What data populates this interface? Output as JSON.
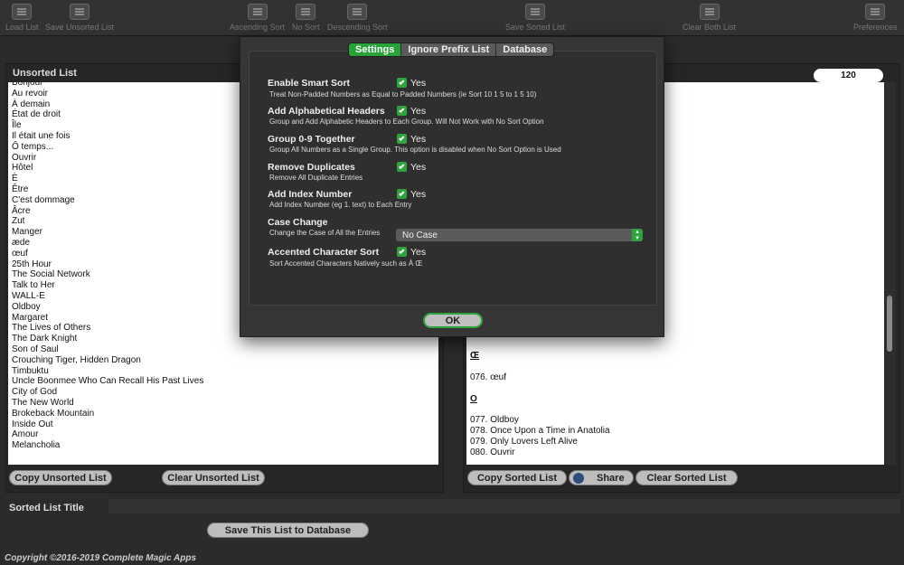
{
  "toolbar": {
    "items": [
      {
        "label": "Load List",
        "icon": "load-icon"
      },
      {
        "label": "Save Unsorted List",
        "icon": "save-icon"
      },
      {
        "label": "Ascending Sort",
        "icon": "ascending-icon"
      },
      {
        "label": "No Sort",
        "icon": "no-sort-icon"
      },
      {
        "label": "Descending Sort",
        "icon": "descending-icon"
      },
      {
        "label": "Save Sorted List",
        "icon": "save-icon"
      },
      {
        "label": "Clear Both List",
        "icon": "trash-icon"
      },
      {
        "label": "Preferences",
        "icon": "tools-icon"
      }
    ]
  },
  "unsorted": {
    "title": "Unsorted List",
    "items": [
      "Bonjour",
      "Au revoir",
      "À demain",
      "État de droit",
      "Île",
      "Il était une fois",
      "Ô temps...",
      "Ouvrir",
      "Hôtel",
      "È",
      "Être",
      "C'est dommage",
      "Âcre",
      "Zut",
      "Manger",
      "æde",
      "œuf",
      "25th Hour",
      "The Social Network",
      "Talk to Her",
      "WALL-E",
      "Oldboy",
      "Margaret",
      "The Lives of Others",
      "The Dark Knight",
      "Son of Saul",
      "Crouching Tiger, Hidden Dragon",
      "Timbuktu",
      "Uncle Boonmee Who Can Recall His Past Lives",
      "City of God",
      "The New World",
      "Brokeback Mountain",
      "Inside Out",
      "Amour",
      "Melancholia"
    ],
    "copy_label": "Copy Unsorted List",
    "clear_label": "Clear Unsorted List"
  },
  "sorted": {
    "count": "120",
    "header_oe": "Œ",
    "item_076": "076. œuf",
    "header_o": "O",
    "items_o": [
      "077. Oldboy",
      "078. Once Upon a Time in Anatolia",
      "079. Only Lovers Left Alive",
      "080. Ouvrir"
    ],
    "copy_label": "Copy Sorted List",
    "share_label": "Share",
    "clear_label": "Clear Sorted List"
  },
  "sorted_title": {
    "label": "Sorted List Title",
    "value": ""
  },
  "save_db_label": "Save This List to Database",
  "footer": "Copyright ©2016-2019 Complete Magic Apps",
  "dialog": {
    "tabs": [
      "Settings",
      "Ignore Prefix List",
      "Database"
    ],
    "options": [
      {
        "title": "Enable Smart Sort",
        "check": "Yes",
        "desc": "Treat Non-Padded Numbers as Equal to Padded Numbers (ie Sort 10 1 5 to 1 5 10)"
      },
      {
        "title": "Add Alphabetical Headers",
        "check": "Yes",
        "desc": "Group and Add Alphabetic Headers to Each Group. Will Not Work with No Sort Option"
      },
      {
        "title": "Group 0-9 Together",
        "check": "Yes",
        "desc": "Group All Numbers as a Single Group. This option is disabled when No Sort Option is Used"
      },
      {
        "title": "Remove Duplicates",
        "check": "Yes",
        "desc": "Remove All Duplicate Entries"
      },
      {
        "title": "Add Index Number",
        "check": "Yes",
        "desc": "Add Index Number (eg 1. text) to Each Entry"
      },
      {
        "title": "Case Change",
        "desc": "Change the Case of All the Entries"
      },
      {
        "title": "Accented Character Sort",
        "check": "Yes",
        "desc": "Sort Accented Characters Natively such as À Œ"
      }
    ],
    "case_value": "No Case",
    "ok_label": "OK"
  }
}
